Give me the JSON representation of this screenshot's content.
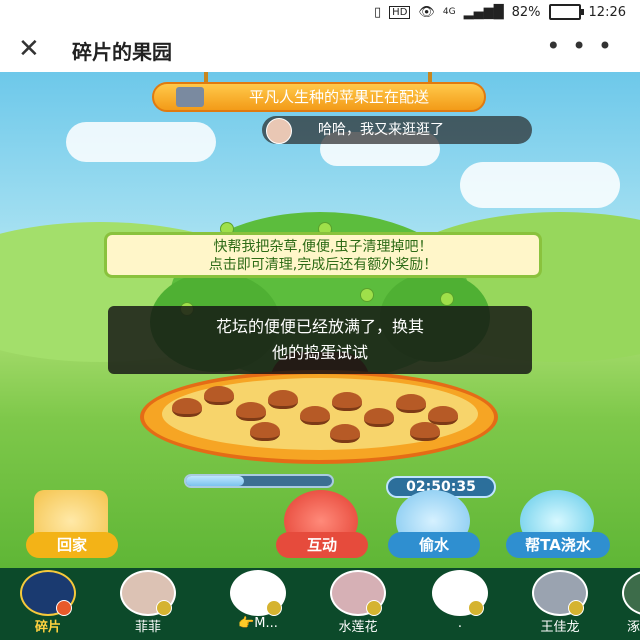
{
  "statusbar": {
    "hd_badge": "HD",
    "network": "4G",
    "battery": "82%",
    "battery_level": 0.82,
    "time": "12:26"
  },
  "header": {
    "title": "碎片的果园",
    "close_icon": "close-icon",
    "more_icon": "more-icon"
  },
  "scene": {
    "banner": "平凡人生种的苹果正在配送",
    "bubble": "哈哈，我又来逛逛了",
    "task_line1": "快帮我把杂草,便便,虫子清理掉吧！",
    "task_line2": "点击即可清理,完成后还有额外奖励！",
    "toast_line1": "花坛的便便已经放满了，换其",
    "toast_line2": "他的捣蛋试试",
    "progress": 0.4,
    "timer": "02:50:35"
  },
  "actions": {
    "home": "回家",
    "interact": "互动",
    "steal": "偷水",
    "water": "帮TA浇水"
  },
  "friends": [
    "碎片",
    "菲菲",
    "👉M...",
    "水莲花",
    ".",
    "王佳龙",
    "涿"
  ],
  "colors": {
    "home_label": "#f3b317",
    "interact_label": "#e64b3c",
    "steal_label": "#2f8fd0",
    "water_label": "#2f8fd0",
    "friend_bar": "#0c4a2a"
  }
}
